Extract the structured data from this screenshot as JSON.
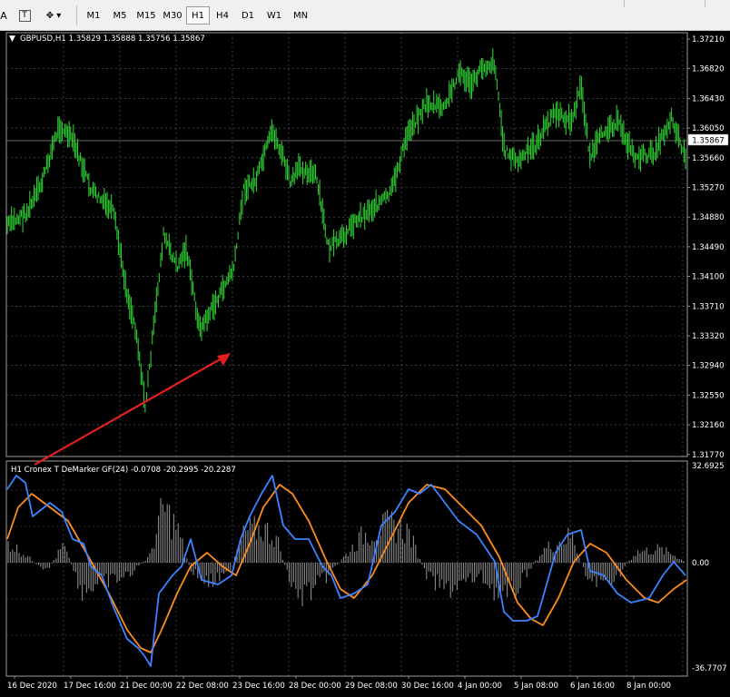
{
  "toolbar": {
    "timeframes": [
      "M1",
      "M5",
      "M15",
      "M30",
      "H1",
      "H4",
      "D1",
      "W1",
      "MN"
    ],
    "active_timeframe": "H1",
    "left_icons": [
      "font-icon",
      "text-icon",
      "shapes-dropdown-icon"
    ]
  },
  "main_chart": {
    "header": "GBPUSD,H1  1.35829 1.35888 1.35756 1.35867",
    "price_labels": [
      "1.37210",
      "1.36820",
      "1.36430",
      "1.36050",
      "1.35660",
      "1.35270",
      "1.34880",
      "1.34490",
      "1.34100",
      "1.33710",
      "1.33320",
      "1.32940",
      "1.32550",
      "1.32160",
      "1.31770"
    ],
    "current_price": "1.35867",
    "candle_color": "#2ec832",
    "price_line_color": "#8c8c8c"
  },
  "indicator": {
    "header": "H1 Cronex T DeMarker GF(24) -0.0708 -20.2995 -20.2287",
    "scale_labels": [
      "32.6925",
      "0.00",
      "-36.7707"
    ],
    "fast_line_color": "#3c82ff",
    "slow_line_color": "#ff8c1e",
    "histogram_color": "#8c8c8c"
  },
  "time_axis": {
    "labels": [
      "16 Dec 2020",
      "17 Dec 16:00",
      "21 Dec 00:00",
      "22 Dec 08:00",
      "23 Dec 16:00",
      "28 Dec 00:00",
      "29 Dec 08:00",
      "30 Dec 16:00",
      "4 Jan 00:00",
      "5 Jan 08:00",
      "6 Jan 16:00",
      "8 Jan 00:00"
    ]
  },
  "annotation": {
    "arrow_color": "#e02020"
  }
}
